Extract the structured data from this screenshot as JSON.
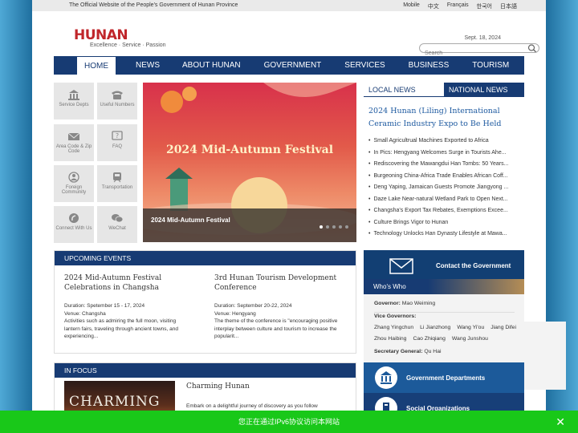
{
  "topbar": {
    "tagline": "The Official Website of the People's Government of Hunan Province",
    "langs": [
      "Mobile",
      "中文",
      "Français",
      "한국어",
      "日本語"
    ]
  },
  "logo": {
    "hunan": "HUNAN",
    "gov": "GOV",
    "slogan": "Excellence · Service · Passion"
  },
  "date": "Sept. 18, 2024",
  "search": {
    "placeholder": "Search"
  },
  "nav": [
    "HOME",
    "NEWS",
    "ABOUT HUNAN",
    "GOVERNMENT",
    "SERVICES",
    "BUSINESS",
    "TOURISM"
  ],
  "tiles": [
    {
      "label": "Service Depts",
      "icon": "building-icon"
    },
    {
      "label": "Useful Numbers",
      "icon": "phone-icon"
    },
    {
      "label": "Area Code & Zip Code",
      "icon": "mail-icon"
    },
    {
      "label": "FAQ",
      "icon": "question-icon"
    },
    {
      "label": "Foreign Community",
      "icon": "people-icon"
    },
    {
      "label": "Transportation",
      "icon": "train-icon"
    },
    {
      "label": "Connect With Us",
      "icon": "connect-icon"
    },
    {
      "label": "WeChat",
      "icon": "wechat-icon"
    }
  ],
  "slider": {
    "title": "2024 Mid-Autumn Festival",
    "caption": "2024 Mid-Autumn Festival",
    "slide_count": 5,
    "active_slide": 1
  },
  "news": {
    "tab_local": "LOCAL NEWS",
    "tab_national": "NATIONAL NEWS",
    "headline": "2024 Hunan (Liling) International Ceramic Industry Expo to Be Held",
    "items": [
      "Small Agricultrual Machines Exported to Africa",
      "In Pics: Hengyang Welcomes Surge in Tourists Ahe...",
      "Rediscovering the Mawangdui Han Tombs: 50 Years...",
      "Burgeoning China-Africa Trade Enables African Coff...",
      "Deng Yaping, Jamaican Guests Promote Jiangyong ...",
      "Daze Lake Near-natural Wetland Park to Open Next...",
      "Changsha's Export Tax Rebates, Exemptions Excee...",
      "Culture Brings Vigor to Hunan",
      "Technology Unlocks Han Dynasty Lifestyle at Mawa..."
    ]
  },
  "events": {
    "header": "UPCOMING EVENTS",
    "items": [
      {
        "title": "2024 Mid-Autumn Festival Celebrations in Changsha",
        "duration": "Duration: Spetember 15 - 17, 2024",
        "venue": "Venue: Changsha",
        "desc": "Activities such as admiring the full moon, visiting lantern fairs, traveling through ancient towns, and experiencing..."
      },
      {
        "title": "3rd Hunan Tourism Development Conference",
        "duration": "Duration: September 20-22, 2024",
        "venue": "Venue: Hengyang",
        "desc": "The theme of the conference is \"encouraging positive interplay between culture and tourism to increase the popularit..."
      }
    ]
  },
  "focus": {
    "header": "IN FOCUS",
    "image_text": "CHARMING",
    "title": "Charming Hunan",
    "desc": "Embark on a delightful journey of discovery as you follow"
  },
  "contact": {
    "label": "Contact the Government"
  },
  "who": {
    "header": "Who's Who",
    "governor_label": "Governor:",
    "governor": "Mao Weiming",
    "vice_label": "Vice Governors:",
    "vice_row1": [
      "Zhang Yingchun",
      "Li Jianzhong",
      "Wang Yi'ou",
      "Jiang Difei"
    ],
    "vice_row2": [
      "Zhou Haibing",
      "Cao Zhiqiang",
      "Wang Junshou"
    ],
    "secretary_label": "Secretary General:",
    "secretary": "Qu Hai"
  },
  "links": {
    "dept": "Government Departments",
    "orgs": "Social Organizations"
  },
  "banner": {
    "text": "您正在通过IPv6协议访问本网站",
    "close": "✕"
  },
  "colors": {
    "navy": "#173b73",
    "red": "#c0262b",
    "green": "#19c819"
  }
}
